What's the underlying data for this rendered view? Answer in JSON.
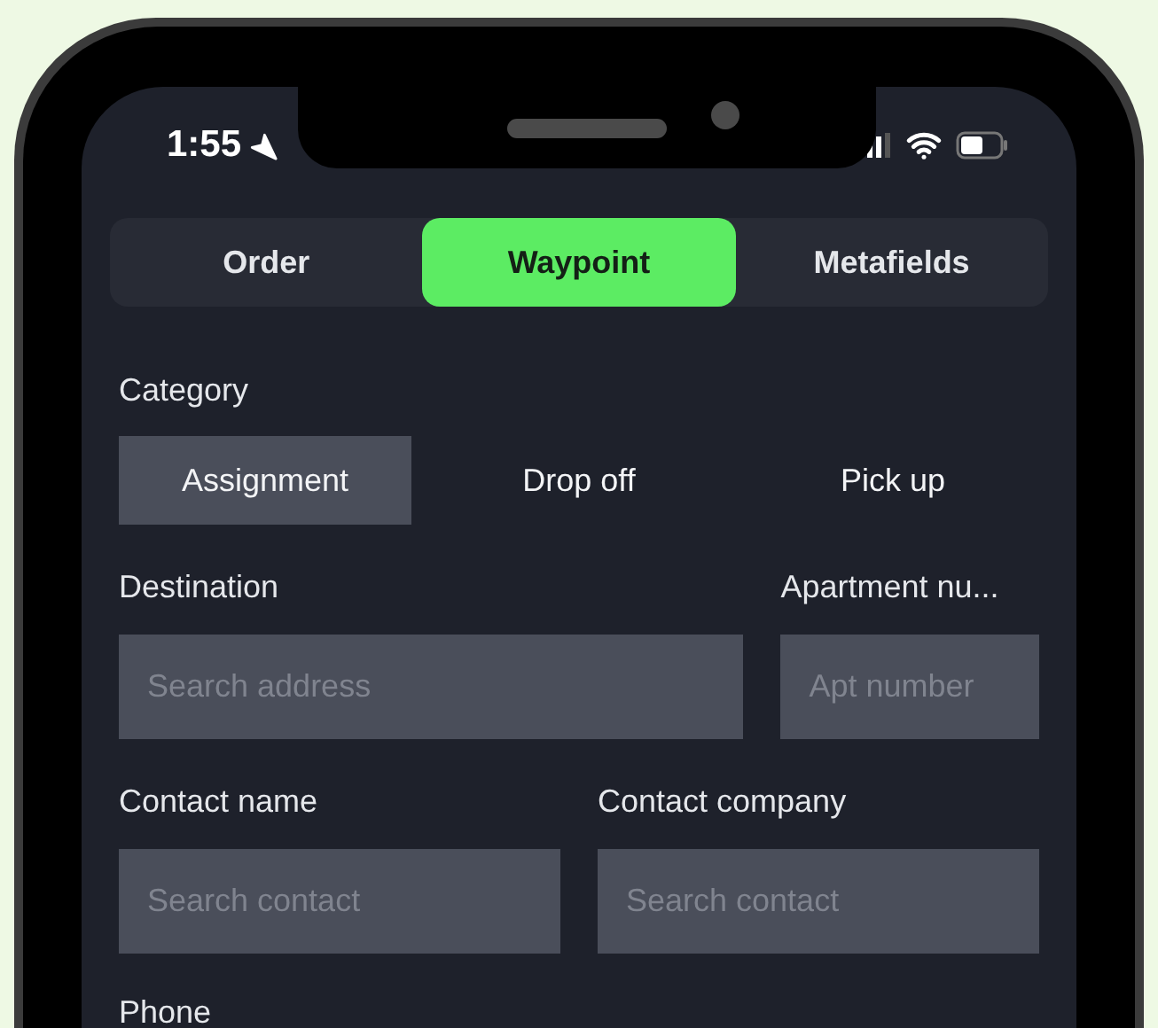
{
  "status_bar": {
    "time": "1:55"
  },
  "tabs": [
    {
      "label": "Order",
      "selected": false
    },
    {
      "label": "Waypoint",
      "selected": true
    },
    {
      "label": "Metafields",
      "selected": false
    }
  ],
  "category": {
    "label": "Category",
    "options": [
      {
        "label": "Assignment",
        "selected": true
      },
      {
        "label": "Drop off",
        "selected": false
      },
      {
        "label": "Pick up",
        "selected": false
      }
    ]
  },
  "field_rows": [
    [
      {
        "label": "Destination",
        "placeholder": "Search address"
      },
      {
        "label": "Apartment nu...",
        "placeholder": "Apt number"
      }
    ],
    [
      {
        "label": "Contact name",
        "placeholder": "Search contact"
      },
      {
        "label": "Contact company",
        "placeholder": "Search contact"
      }
    ]
  ],
  "phone": {
    "label": "Phone"
  }
}
